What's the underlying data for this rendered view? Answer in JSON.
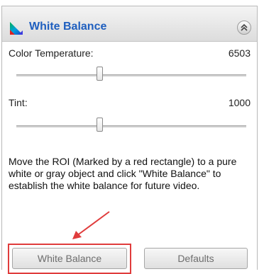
{
  "panel": {
    "title": "White Balance",
    "title_color": "#1f5fbf",
    "icons": {
      "title": "color-gamut-icon",
      "collapse": "double-chevron-up-icon"
    }
  },
  "controls": {
    "color_temperature": {
      "label": "Color Temperature:",
      "value": "6503",
      "slider_fraction": 0.36
    },
    "tint": {
      "label": "Tint:",
      "value": "1000",
      "slider_fraction": 0.36
    }
  },
  "description": "Move the ROI (Marked by a red rectangle) to a pure white or gray object and click \"White Balance\" to establish the white balance for future video.",
  "buttons": {
    "white_balance": "White Balance",
    "defaults": "Defaults"
  },
  "annotation": {
    "highlight_color": "#e03c3c"
  }
}
